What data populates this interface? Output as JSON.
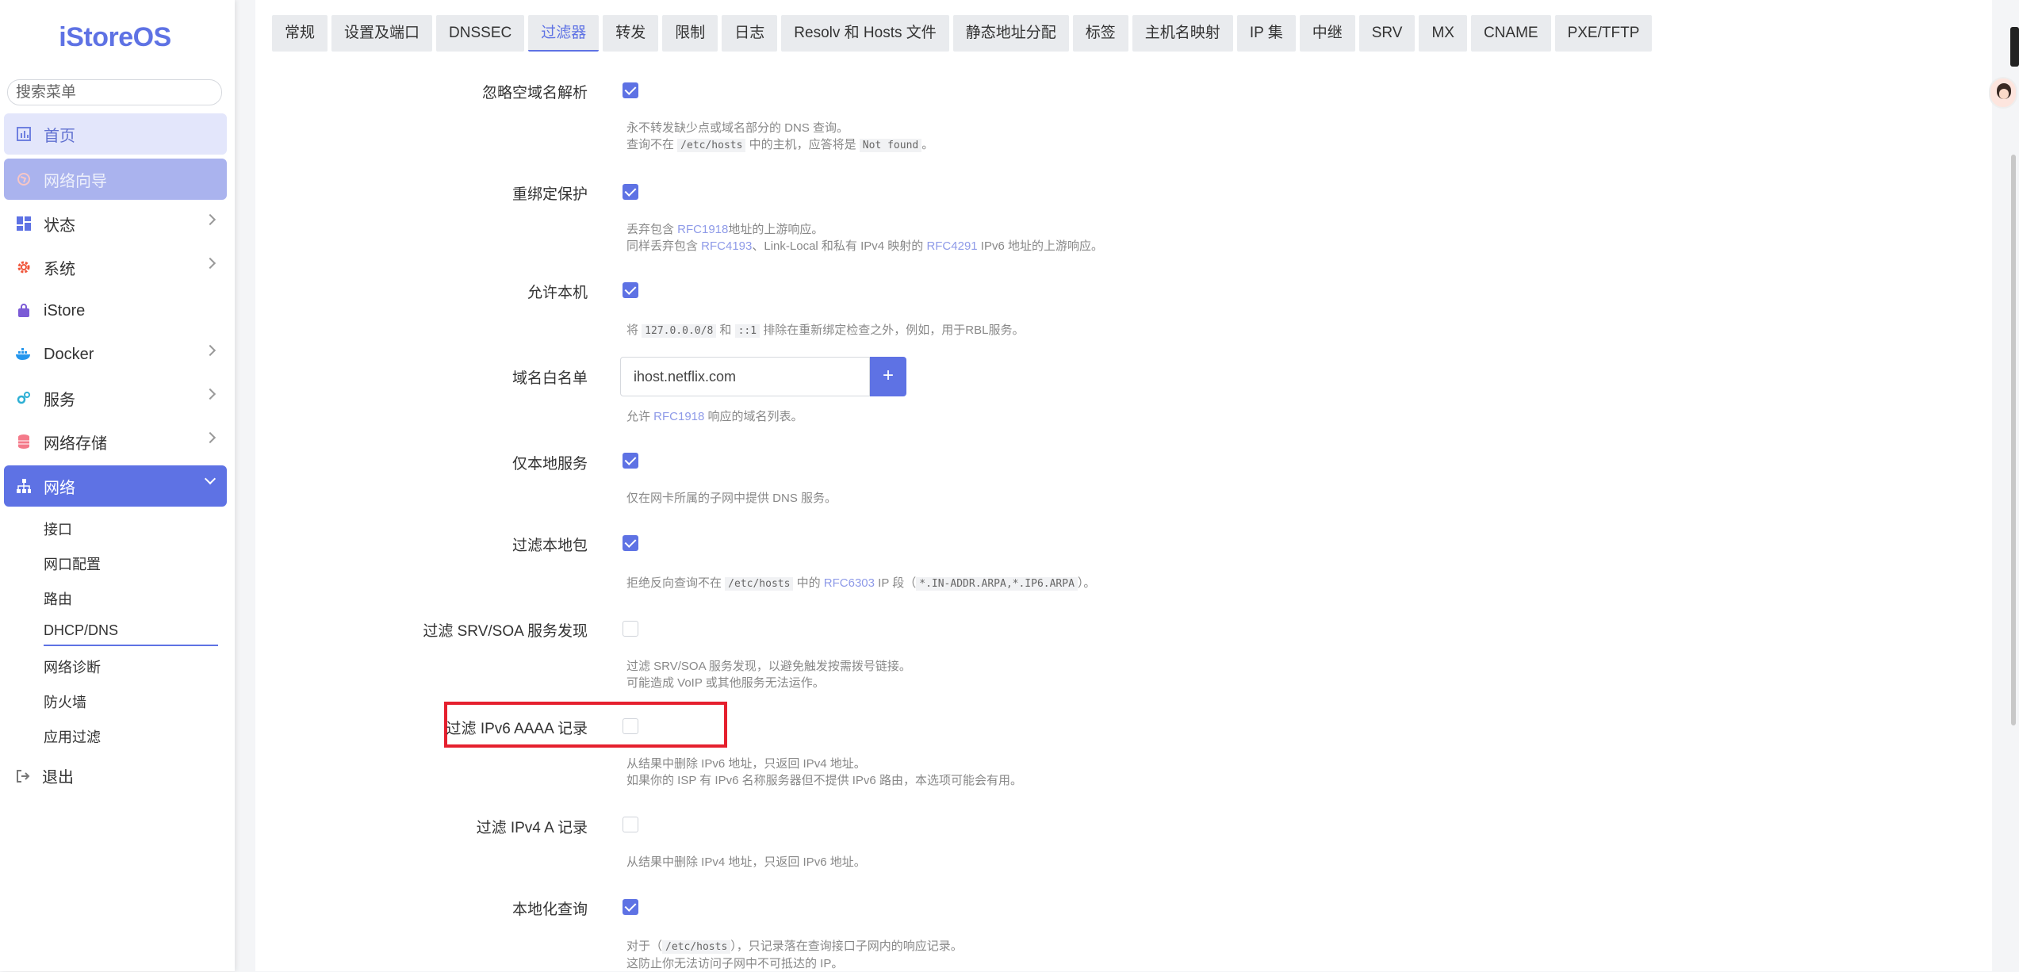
{
  "sidebar": {
    "logo": "iStoreOS",
    "search_placeholder": "搜索菜单",
    "items": [
      {
        "label": "首页"
      },
      {
        "label": "网络向导"
      },
      {
        "label": "状态"
      },
      {
        "label": "系统"
      },
      {
        "label": "iStore"
      },
      {
        "label": "Docker"
      },
      {
        "label": "服务"
      },
      {
        "label": "网络存储"
      },
      {
        "label": "网络"
      }
    ],
    "sub_items": [
      "接口",
      "网口配置",
      "路由",
      "DHCP/DNS",
      "网络诊断",
      "防火墙",
      "应用过滤"
    ],
    "logout": "退出"
  },
  "tabs": [
    "常规",
    "设置及端口",
    "DNSSEC",
    "过滤器",
    "转发",
    "限制",
    "日志",
    "Resolv 和 Hosts 文件",
    "静态地址分配",
    "标签",
    "主机名映射",
    "IP 集",
    "中继",
    "SRV",
    "MX",
    "CNAME",
    "PXE/TFTP"
  ],
  "active_tab": "过滤器",
  "settings": {
    "domain_needed": {
      "label": "忽略空域名解析",
      "checked": true,
      "d1": "永不转发缺少点或域名部分的 DNS 查询。",
      "d2a": "查询不在 ",
      "d2code": "/etc/hosts",
      "d2b": " 中的主机，应答将是 ",
      "d2code2": "Not found",
      "d2c": "。"
    },
    "rebind_protection": {
      "label": "重绑定保护",
      "checked": true,
      "d1a": "丢弃包含 ",
      "d1link": "RFC1918",
      "d1b": "地址的上游响应。",
      "d2a": "同样丢弃包含 ",
      "d2link": "RFC4193",
      "d2b": "、Link-Local 和私有 IPv4 映射的 ",
      "d2link2": "RFC4291",
      "d2c": " IPv6 地址的上游响应。"
    },
    "rebind_localhost": {
      "label": "允许本机",
      "checked": true,
      "d1a": "将 ",
      "d1code": "127.0.0.0/8",
      "d1b": " 和 ",
      "d1code2": "::1",
      "d1c": " 排除在重新绑定检查之外，例如，用于RBL服务。"
    },
    "rebind_domain": {
      "label": "域名白名单",
      "value": "ihost.netflix.com",
      "add": "+",
      "d1a": "允许 ",
      "d1link": "RFC1918",
      "d1b": " 响应的域名列表。"
    },
    "local_service": {
      "label": "仅本地服务",
      "checked": true,
      "d1": "仅在网卡所属的子网中提供 DNS 服务。"
    },
    "boguspriv": {
      "label": "过滤本地包",
      "checked": true,
      "d1a": "拒绝反向查询不在 ",
      "d1code": "/etc/hosts",
      "d1b": " 中的 ",
      "d1link": "RFC6303",
      "d1c": " IP 段（",
      "d1code2": "*.IN-ADDR.ARPA,*.IP6.ARPA",
      "d1d": "）。"
    },
    "filterwin2k": {
      "label": "过滤 SRV/SOA 服务发现",
      "checked": false,
      "d1": "过滤 SRV/SOA 服务发现，以避免触发按需拨号链接。",
      "d2": "可能造成 VoIP 或其他服务无法运作。"
    },
    "filter_aaaa": {
      "label": "过滤 IPv6 AAAA 记录",
      "checked": false,
      "d1": "从结果中删除 IPv6 地址，只返回 IPv4 地址。",
      "d2": "如果你的 ISP 有 IPv6 名称服务器但不提供 IPv6 路由，本选项可能会有用。"
    },
    "filter_a": {
      "label": "过滤 IPv4 A 记录",
      "checked": false,
      "d1": "从结果中删除 IPv4 地址，只返回 IPv6 地址。"
    },
    "localise_queries": {
      "label": "本地化查询",
      "checked": true,
      "d1a": "对于（",
      "d1code": "/etc/hosts",
      "d1b": "），只记录落在查询接口子网内的响应记录。",
      "d2": "这防止你无法访问子网中不可抵达的 IP。"
    }
  },
  "colors": {
    "accent": "#5e72e4",
    "highlight": "#e5202e"
  }
}
